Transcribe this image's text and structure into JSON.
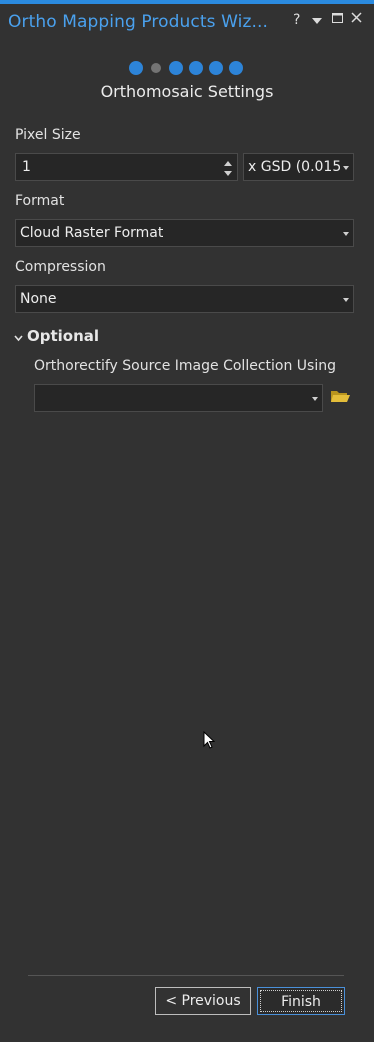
{
  "window": {
    "title": "Ortho Mapping Products Wiz...",
    "help_label": "?",
    "accent": "#2b8be0"
  },
  "wizard": {
    "current_step": 2,
    "total_steps": 6,
    "step_title": "Orthomosaic Settings"
  },
  "pixel_size": {
    "label": "Pixel Size",
    "value": "1",
    "unit_selected": "x GSD (0.015;"
  },
  "format": {
    "label": "Format",
    "selected": "Cloud Raster Format"
  },
  "compression": {
    "label": "Compression",
    "selected": "None"
  },
  "optional": {
    "label": "Optional",
    "orthorectify_label": "Orthorectify Source Image Collection Using",
    "orthorectify_value": ""
  },
  "footer": {
    "previous_label": "< Previous",
    "finish_label": "Finish"
  }
}
